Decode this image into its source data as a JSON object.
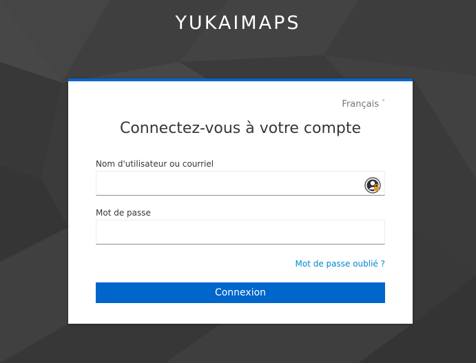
{
  "brand": {
    "name": "YUKAIMAPS"
  },
  "login": {
    "language": "Français",
    "title": "Connectez-vous à votre compte",
    "username_label": "Nom d'utilisateur ou courriel",
    "username_value": "",
    "password_label": "Mot de passe",
    "password_value": "",
    "forgot_link": "Mot de passe oublié ?",
    "submit_label": "Connexion"
  },
  "icons": {
    "language_chevron": "chevron-down-icon",
    "password_manager": "password-manager-icon"
  },
  "colors": {
    "accent": "#0066cc",
    "link": "#0088ce",
    "background": "#3a3a3a"
  }
}
